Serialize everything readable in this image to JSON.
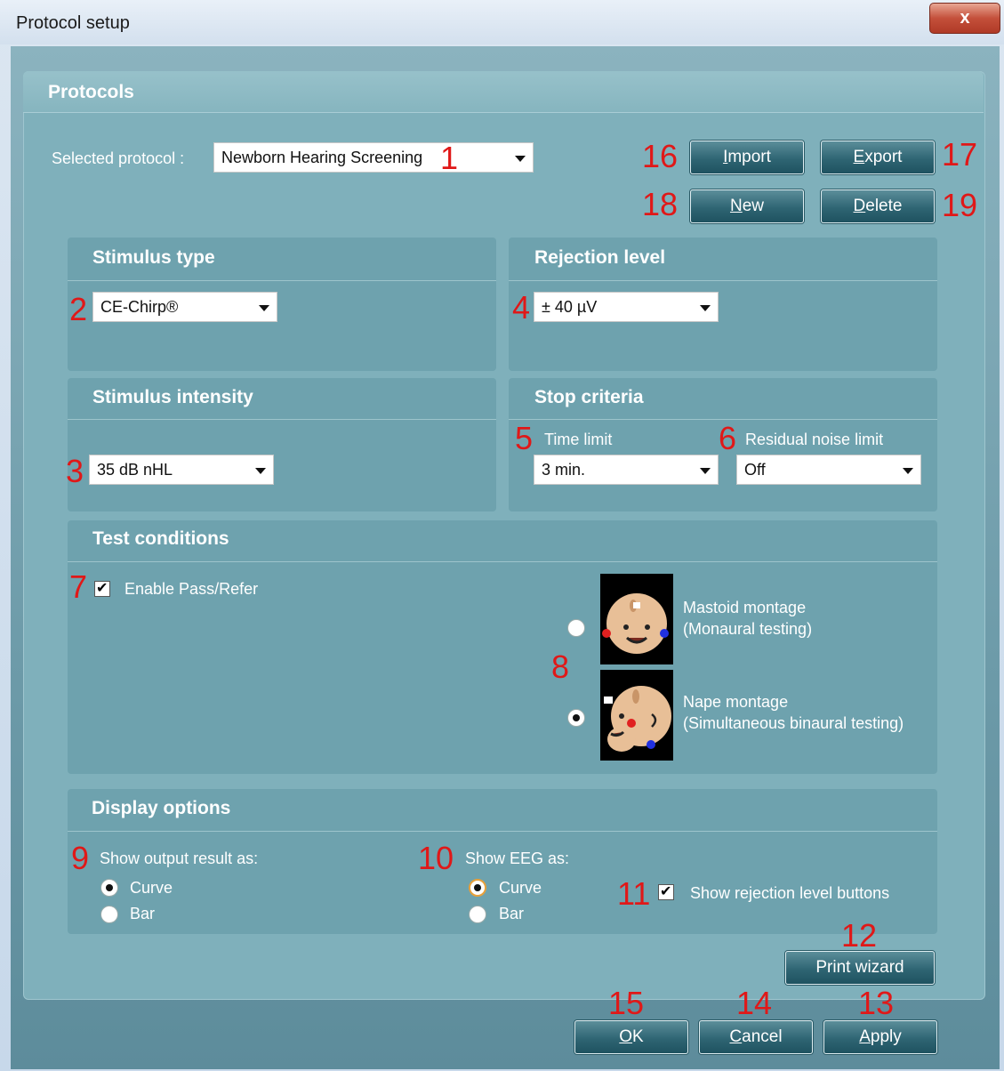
{
  "window": {
    "title": "Protocol setup",
    "close_glyph": "x"
  },
  "protocols": {
    "heading": "Protocols",
    "selected_label": "Selected protocol :",
    "selected_value": "Newborn Hearing Screening"
  },
  "buttons": {
    "import_u": "I",
    "import_rest": "mport",
    "export_u": "E",
    "export_rest": "xport",
    "new_u": "N",
    "new_rest": "ew",
    "delete_u": "D",
    "delete_rest": "elete",
    "print_wizard": "Print wizard",
    "ok_u": "O",
    "ok_rest": "K",
    "cancel_u": "C",
    "cancel_rest": "ancel",
    "apply_u": "A",
    "apply_rest": "pply"
  },
  "stimulus_type": {
    "heading": "Stimulus type",
    "value": "CE-Chirp®"
  },
  "rejection_level": {
    "heading": "Rejection level",
    "value": "± 40 µV"
  },
  "stimulus_intensity": {
    "heading": "Stimulus intensity",
    "value": "35 dB nHL"
  },
  "stop_criteria": {
    "heading": "Stop criteria",
    "time_limit_label": "Time limit",
    "time_limit_value": "3 min.",
    "residual_label": "Residual noise limit",
    "residual_value": "Off"
  },
  "test_conditions": {
    "heading": "Test conditions",
    "enable_pass_refer": "Enable Pass/Refer",
    "mastoid_line1": "Mastoid montage",
    "mastoid_line2": "(Monaural testing)",
    "nape_line1": "Nape montage",
    "nape_line2": "(Simultaneous binaural testing)"
  },
  "display_options": {
    "heading": "Display options",
    "output_label": "Show output result as:",
    "output_curve": "Curve",
    "output_bar": "Bar",
    "eeg_label": "Show EEG as:",
    "eeg_curve": "Curve",
    "eeg_bar": "Bar",
    "show_rejection": "Show rejection level buttons"
  },
  "annotations": [
    "1",
    "2",
    "3",
    "4",
    "5",
    "6",
    "7",
    "8",
    "9",
    "10",
    "11",
    "12",
    "13",
    "14",
    "15",
    "16",
    "17",
    "18",
    "19"
  ],
  "colors": {
    "annotation_red": "#e01818",
    "panel_teal": "#6ea2ae",
    "button_dark": "#2f6573"
  }
}
